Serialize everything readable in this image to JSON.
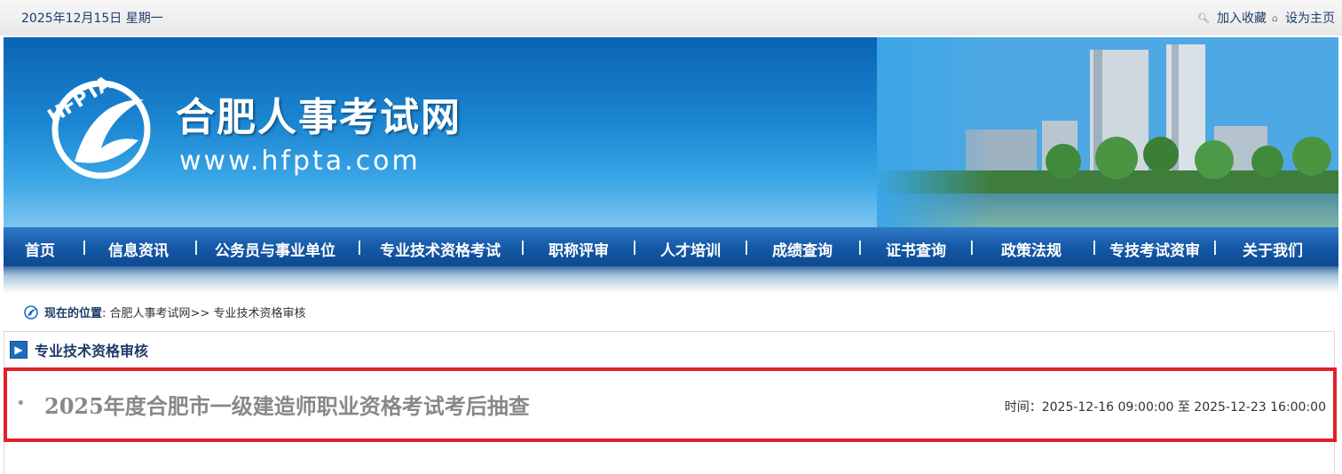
{
  "topbar": {
    "date": "2025年12月15日 星期一",
    "favorite_label": "加入收藏",
    "homepage_label": "设为主页"
  },
  "header": {
    "logo_text": "HFPTA",
    "site_title": "合肥人事考试网",
    "site_url": "www.hfpta.com"
  },
  "nav": {
    "items": [
      "首页",
      "信息资讯",
      "公务员与事业单位",
      "专业技术资格考试",
      "职称评审",
      "人才培训",
      "成绩查询",
      "证书查询",
      "政策法规",
      "专技考试资审",
      "关于我们"
    ],
    "separator": "|"
  },
  "breadcrumb": {
    "label": "现在的位置",
    "path": ": 合肥人事考试网>> 专业技术资格审核"
  },
  "section": {
    "title": "专业技术资格审核"
  },
  "list": {
    "items": [
      {
        "title": "2025年度合肥市一级建造师职业资格考试考后抽查",
        "time": "时间：2025-12-16 09:00:00 至 2025-12-23 16:00:00"
      }
    ]
  },
  "colors": {
    "nav_blue": "#1559a7",
    "highlight_red": "#e0202a",
    "text_navy": "#1e3d6b"
  }
}
